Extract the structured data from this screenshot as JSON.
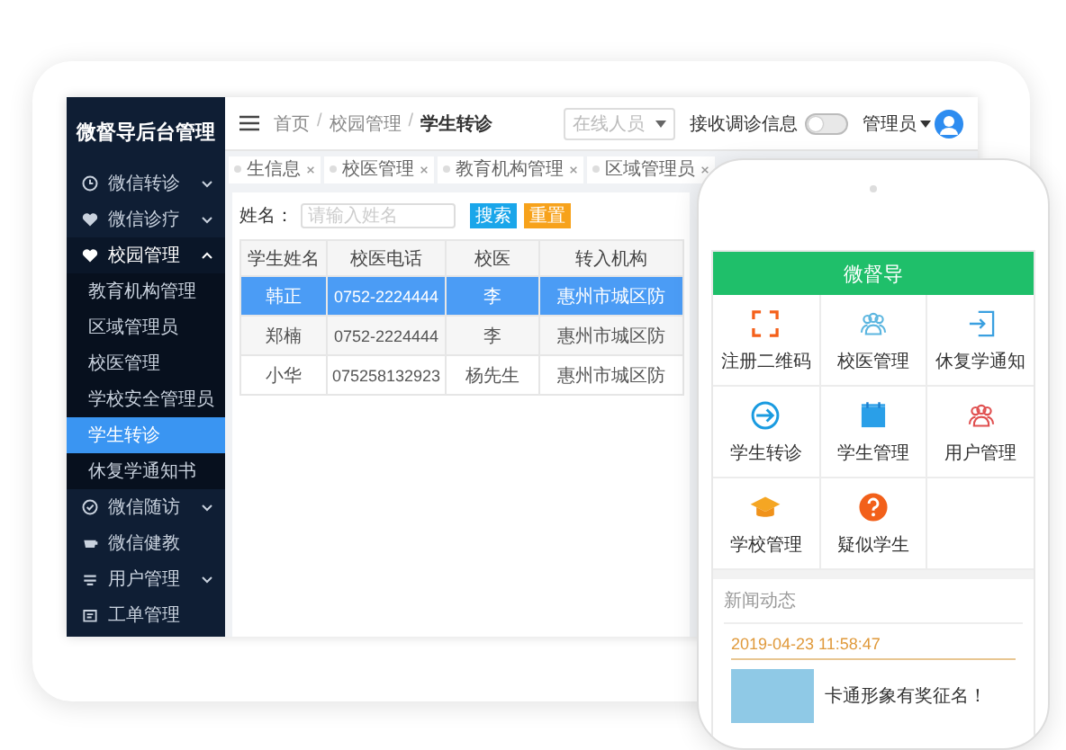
{
  "sidebar": {
    "title": "微督导后台管理",
    "items": [
      {
        "label": "微信转诊",
        "kind": "menu",
        "expanded": false
      },
      {
        "label": "微信诊疗",
        "kind": "menu",
        "expanded": false
      },
      {
        "label": "校园管理",
        "kind": "menu",
        "expanded": true,
        "children": [
          {
            "label": "教育机构管理",
            "selected": false
          },
          {
            "label": "区域管理员",
            "selected": false
          },
          {
            "label": "校医管理",
            "selected": false
          },
          {
            "label": "学校安全管理员",
            "selected": false
          },
          {
            "label": "学生转诊",
            "selected": true
          },
          {
            "label": "休复学通知书",
            "selected": false
          }
        ]
      },
      {
        "label": "微信随访",
        "kind": "menu",
        "expanded": false
      },
      {
        "label": "微信健教",
        "kind": "link",
        "expanded": false
      },
      {
        "label": "用户管理",
        "kind": "menu",
        "expanded": false
      },
      {
        "label": "工单管理",
        "kind": "link",
        "expanded": false
      }
    ]
  },
  "header": {
    "breadcrumb": {
      "items": [
        "首页",
        "校园管理",
        "学生转诊"
      ],
      "separator": "/"
    },
    "online_select": {
      "placeholder": "在线人员"
    },
    "sync_toggle": {
      "label": "接收调诊信息",
      "on": false
    },
    "user": {
      "name": "管理员"
    }
  },
  "tabs": [
    {
      "label": "生信息",
      "selected": false
    },
    {
      "label": "校医管理",
      "selected": false
    },
    {
      "label": "教育机构管理",
      "selected": false
    },
    {
      "label": "区域管理员",
      "selected": false
    }
  ],
  "search": {
    "label": "姓名：",
    "placeholder": "请输入姓名",
    "buttons": [
      {
        "label": "搜索",
        "kind": "primary"
      },
      {
        "label": "重置",
        "kind": "warning"
      }
    ]
  },
  "table": {
    "columns": [
      "学生姓名",
      "校医电话",
      "校医",
      "转入机构"
    ],
    "rows": [
      {
        "cells": [
          "韩正",
          "0752-2224444",
          "李",
          "惠州市城区防"
        ],
        "selected": true
      },
      {
        "cells": [
          "郑楠",
          "0752-2224444",
          "李",
          "惠州市城区防"
        ],
        "selected": false
      },
      {
        "cells": [
          "小华",
          "075258132923",
          "杨先生",
          "惠州市城区防"
        ],
        "selected": false
      }
    ]
  },
  "phone": {
    "title": "微督导",
    "tiles": [
      {
        "label": "注册二维码"
      },
      {
        "label": "校医管理"
      },
      {
        "label": "休复学通知"
      },
      {
        "label": "学生转诊"
      },
      {
        "label": "学生管理"
      },
      {
        "label": "用户管理"
      },
      {
        "label": "学校管理"
      },
      {
        "label": "疑似学生"
      }
    ],
    "news": {
      "heading": "新闻动态",
      "date": "2019-04-23 11:58:47",
      "items": [
        {
          "title": "卡通形象有奖征名！"
        }
      ]
    }
  }
}
